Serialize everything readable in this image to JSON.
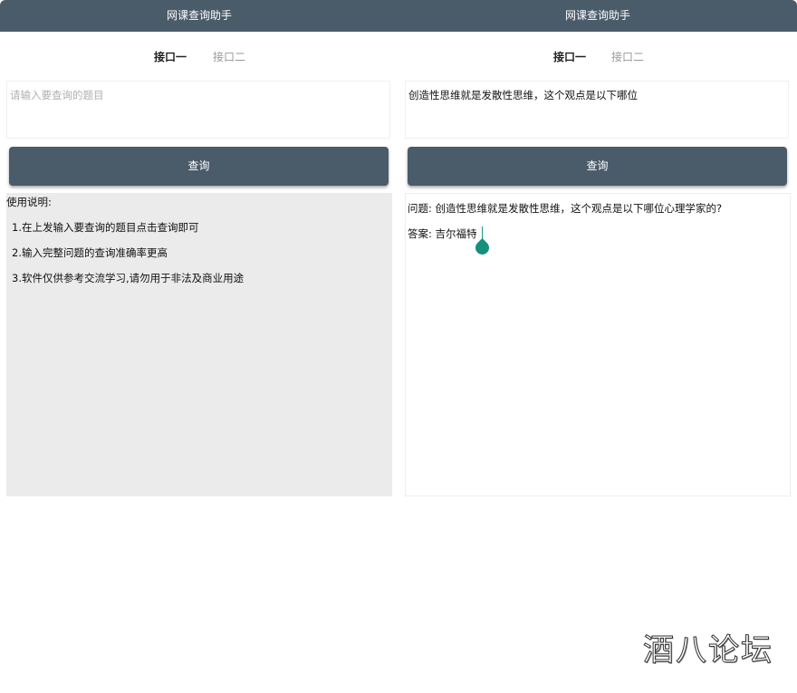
{
  "left": {
    "app_title": "网课查询助手",
    "tabs": [
      {
        "label": "接口一",
        "active": true
      },
      {
        "label": "接口二",
        "active": false
      }
    ],
    "input": {
      "placeholder": "请输入要查询的题目",
      "value": ""
    },
    "query_button": "查询",
    "help": {
      "title": "使用说明:",
      "items": [
        "1.在上发输入要查询的题目点击查询即可",
        "2.输入完整问题的查询准确率更高",
        "3.软件仅供参考交流学习,请勿用于非法及商业用途"
      ]
    }
  },
  "right": {
    "app_title": "网课查询助手",
    "tabs": [
      {
        "label": "接口一",
        "active": true
      },
      {
        "label": "接口二",
        "active": false
      }
    ],
    "input": {
      "placeholder": "",
      "value": "创造性思维就是发散性思维，这个观点是以下哪位"
    },
    "query_button": "查询",
    "result": {
      "question": "问题: 创造性思维就是发散性思维，这个观点是以下哪位心理学家的?",
      "answer": "答案: 吉尔福特"
    }
  },
  "watermark": "酒八论坛",
  "colors": {
    "appbar": "#4a5b6a",
    "button": "#4a5b6a",
    "help_panel_bg": "#ebebeb",
    "cursor_handle": "#168f7c"
  }
}
